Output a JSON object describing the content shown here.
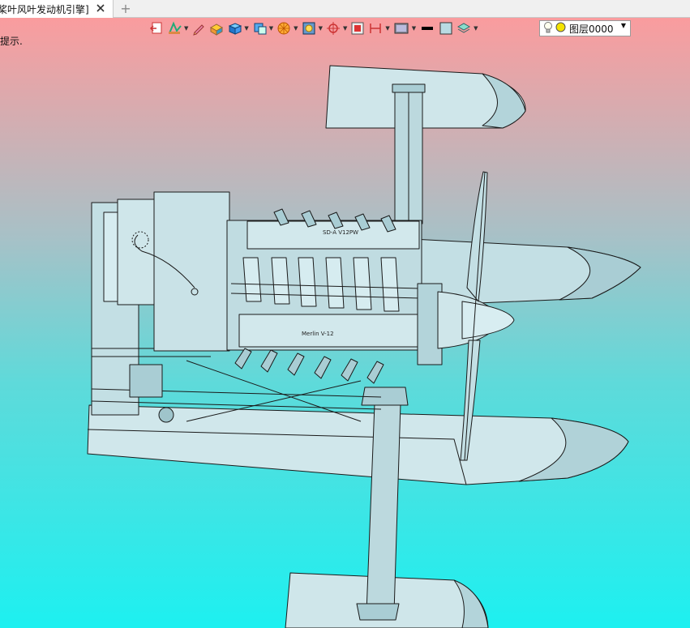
{
  "tab": {
    "title": "桨叶风叶发动机引擎]",
    "close_icon": "close-x-icon",
    "new_tab_icon": "plus-icon",
    "new_tab_glyph": "+"
  },
  "prompt": {
    "text": "提示."
  },
  "toolbar": {
    "icons": [
      "exit-sketch-icon",
      "sketch-style-icon",
      "pencil-icon",
      "extrude-solid-icon",
      "cube-view-icon",
      "section-view-icon",
      "render-style-icon",
      "texture-icon",
      "snap-point-icon",
      "frame-icon",
      "dimension-icon",
      "display-mode-icon",
      "line-color-icon",
      "fill-color-icon",
      "layer-manager-icon"
    ],
    "layer": {
      "name": "图层0000",
      "bulb_icon": "lightbulb-icon",
      "state_icon": "layer-state-circle-icon",
      "dropdown_icon": "dropdown-arrow-icon"
    }
  },
  "model": {
    "engine_label_top": "SD-A V12PW",
    "engine_label_bottom": "Merlin V-12"
  },
  "colors": {
    "viewport_top": "#fa9c9e",
    "viewport_bottom": "#1df0f0",
    "part_fill": "#c7e1e6",
    "part_fill_light": "#d6ecf0",
    "part_stroke": "#1a1a1a"
  }
}
